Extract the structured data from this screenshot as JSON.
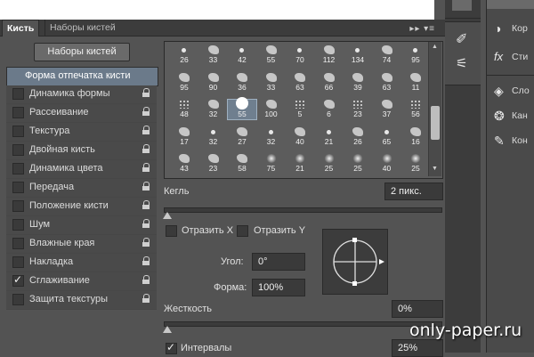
{
  "tabs": {
    "brush": "Кисть",
    "presets": "Наборы кистей"
  },
  "presets_button": "Наборы кистей",
  "sidebar": {
    "header": "Форма отпечатка кисти",
    "items": [
      {
        "label": "Динамика формы",
        "checked": false
      },
      {
        "label": "Рассеивание",
        "checked": false
      },
      {
        "label": "Текстура",
        "checked": false
      },
      {
        "label": "Двойная кисть",
        "checked": false
      },
      {
        "label": "Динамика цвета",
        "checked": false
      },
      {
        "label": "Передача",
        "checked": false
      },
      {
        "label": "Положение кисти",
        "checked": false
      },
      {
        "label": "Шум",
        "checked": false
      },
      {
        "label": "Влажные края",
        "checked": false
      },
      {
        "label": "Накладка",
        "checked": false
      },
      {
        "label": "Сглаживание",
        "checked": true
      },
      {
        "label": "Защита текстуры",
        "checked": false
      }
    ]
  },
  "brush_grid": {
    "rows": [
      [
        "26",
        "33",
        "42",
        "55",
        "70",
        "112",
        "134",
        "74",
        "95"
      ],
      [
        "95",
        "90",
        "36",
        "33",
        "63",
        "66",
        "39",
        "63",
        "11"
      ],
      [
        "48",
        "32",
        "55",
        "100",
        "5",
        "6",
        "23",
        "37",
        "56"
      ],
      [
        "17",
        "32",
        "27",
        "32",
        "40",
        "21",
        "26",
        "65",
        "16"
      ],
      [
        "43",
        "23",
        "58",
        "75",
        "21",
        "25",
        "25",
        "40",
        "25"
      ]
    ],
    "selected_index": 20
  },
  "controls": {
    "size_label": "Кегль",
    "size_value": "2 пикс.",
    "flip_x_label": "Отразить X",
    "flip_y_label": "Отразить Y",
    "angle_label": "Угол:",
    "angle_value": "0°",
    "roundness_label": "Форма:",
    "roundness_value": "100%",
    "hardness_label": "Жесткость",
    "hardness_value": "0%",
    "spacing_label": "Интервалы",
    "spacing_value": "25%",
    "spacing_checked": true
  },
  "dock": {
    "items": [
      "Кор",
      "Сти",
      "Сло",
      "Кан",
      "Кон"
    ]
  },
  "watermark": "only-paper.ru"
}
